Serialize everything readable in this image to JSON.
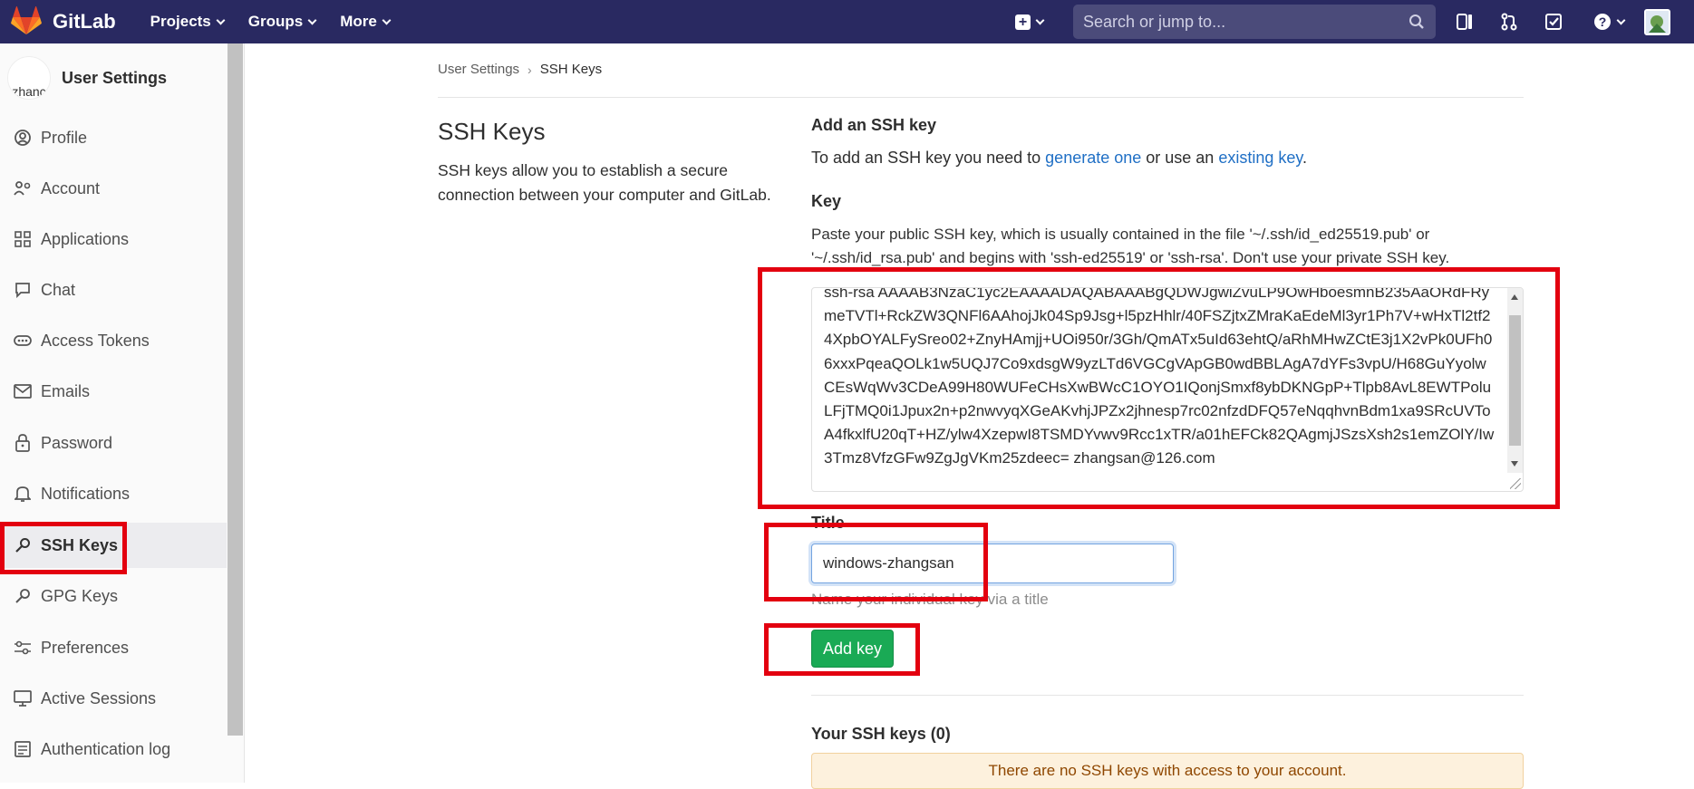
{
  "navbar": {
    "brand": "GitLab",
    "menu": [
      {
        "label": "Projects"
      },
      {
        "label": "Groups"
      },
      {
        "label": "More"
      }
    ],
    "search_placeholder": "Search or jump to..."
  },
  "sidebar": {
    "context_title": "User Settings",
    "avatar_alt": "zhanc",
    "items": [
      {
        "label": "Profile",
        "icon": "profile-icon"
      },
      {
        "label": "Account",
        "icon": "account-icon"
      },
      {
        "label": "Applications",
        "icon": "applications-icon"
      },
      {
        "label": "Chat",
        "icon": "chat-icon"
      },
      {
        "label": "Access Tokens",
        "icon": "token-icon"
      },
      {
        "label": "Emails",
        "icon": "email-icon"
      },
      {
        "label": "Password",
        "icon": "lock-icon"
      },
      {
        "label": "Notifications",
        "icon": "bell-icon"
      },
      {
        "label": "SSH Keys",
        "icon": "key-icon",
        "active": true
      },
      {
        "label": "GPG Keys",
        "icon": "key-icon"
      },
      {
        "label": "Preferences",
        "icon": "preferences-icon"
      },
      {
        "label": "Active Sessions",
        "icon": "monitor-icon"
      },
      {
        "label": "Authentication log",
        "icon": "log-icon"
      }
    ]
  },
  "breadcrumb": {
    "parent": "User Settings",
    "current": "SSH Keys"
  },
  "section": {
    "title": "SSH Keys",
    "description": "SSH keys allow you to establish a secure connection between your computer and GitLab."
  },
  "form": {
    "add_heading": "Add an SSH key",
    "add_text_before": "To add an SSH key you need to ",
    "generate_link": "generate one",
    "add_text_mid": " or use an ",
    "existing_link": "existing key",
    "add_text_after": ".",
    "key_label": "Key",
    "key_help": "Paste your public SSH key, which is usually contained in the file '~/.ssh/id_ed25519.pub' or '~/.ssh/id_rsa.pub' and begins with 'ssh-ed25519' or 'ssh-rsa'. Don't use your private SSH key.",
    "key_value": "ssh-rsa AAAAB3NzaC1yc2EAAAADAQABAAABgQDWJgwiZvuLP9OwHboesmnB235AaORdFRymeTVTl+RckZW3QNFl6AAhojJk04Sp9Jsg+l5pzHhlr/40FSZjtxZMraKaEdeMl3yr1Ph7V+wHxTl2tf24XpbOYALFySreo02+ZnyHAmjj+UOi950r/3Gh/QmATx5uId63ehtQ/aRhMHwZCtE3j1X2vPk0UFh06xxxPqeaQOLk1w5UQJ7Co9xdsgW9yzLTd6VGCgVApGB0wdBBLAgA7dYFs3vpU/H68GuYyolwCEsWqWv3CDeA99H80WUFeCHsXwBWcC1OYO1IQonjSmxf8ybDKNGpP+Tlpb8AvL8EWTPoluLFjTMQ0i1Jpux2n+p2nwvyqXGeAKvhjJPZx2jhnesp7rc02nfzdDFQ57eNqqhvnBdm1xa9SRcUVToA4fkxlfU20qT+HZ/ylw4XzepwI8TSMDYvwv9Rcc1xTR/a01hEFCk82QAgmjJSzsXsh2s1emZOlY/Iw3Tmz8VfzGFw9ZgJgVKm25zdeec= zhangsan@126.com",
    "title_label": "Title",
    "title_value": "windows-zhangsan",
    "title_hint": "Name your individual key via a title",
    "add_button": "Add key",
    "your_keys_heading": "Your SSH keys (0)",
    "no_keys_notice": "There are no SSH keys with access to your account."
  },
  "colors": {
    "navbar": "#292961",
    "button": "#1aaa55",
    "link": "#1f6fc5",
    "annotation": "#e3000f"
  }
}
